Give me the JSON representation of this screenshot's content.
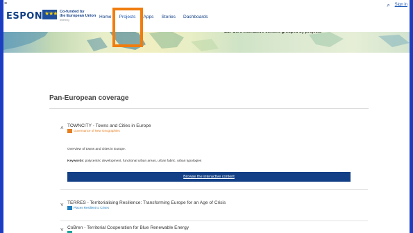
{
  "header": {
    "menu_glyph": "≡",
    "logo_text": "ESPON",
    "eu_stars": "★★★",
    "cofund_line1": "Co-funded by",
    "cofund_line2": "the European Union",
    "cofund_line3": "Interreg",
    "search_glyph": "⌕",
    "signin_label": "Sign in"
  },
  "nav": {
    "items": [
      {
        "label": "Home"
      },
      {
        "label": "Projects"
      },
      {
        "label": "Apps"
      },
      {
        "label": "Stories"
      },
      {
        "label": "Dashboards"
      }
    ]
  },
  "banner": {
    "text": "ESPON's interactive content grouped by projects"
  },
  "main": {
    "section_title": "Pan-European coverage",
    "projects": [
      {
        "title": "TOWNCITY - Towns and Cities in Europe",
        "tag": "Governance of New Geographies",
        "tag_color": "#e67e22",
        "chevron": "˄",
        "expanded": true
      },
      {
        "title": "TERRES - Territorialising Resilience: Transforming Europe for an Age of Crisis",
        "tag": "Places Resilient to Crises",
        "tag_color": "#1f7fc0",
        "chevron": "˅",
        "expanded": false
      },
      {
        "title": "CoBren - Territorial Cooperation for Blue Renewable Energy",
        "tag": "",
        "tag_color": "#1aa39a",
        "chevron": "˅",
        "expanded": false
      }
    ],
    "expanded_detail": {
      "description": "Overview of towns and cities in Europe.",
      "keywords_label": "Keywords",
      "keywords_value": ": polycentric development, functional urban areas, urban fabric, urban typologies",
      "browse_label": "Browse the interactive content"
    }
  },
  "colors": {
    "frame": "#1a3dc2",
    "navy": "#123f86",
    "highlight": "#f07d0e"
  }
}
